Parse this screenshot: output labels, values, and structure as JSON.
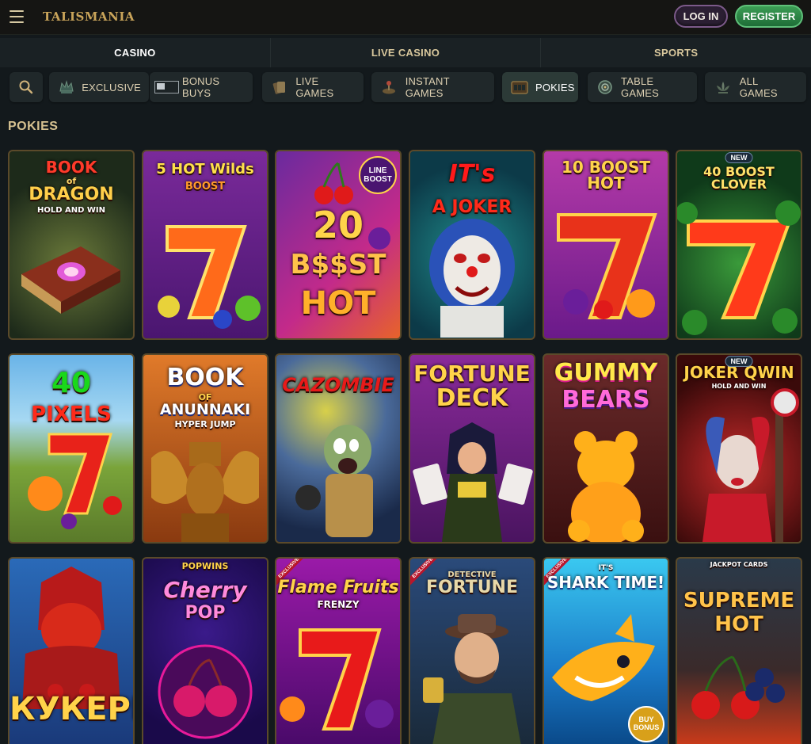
{
  "header": {
    "logo": "TALISMANIA",
    "login_label": "LOG IN",
    "register_label": "REGISTER"
  },
  "main_tabs": [
    {
      "label": "CASINO",
      "active": true
    },
    {
      "label": "LIVE CASINO",
      "active": false
    },
    {
      "label": "SPORTS",
      "active": false
    }
  ],
  "categories": [
    {
      "label": "",
      "icon": "search-icon"
    },
    {
      "label": "EXCLUSIVE",
      "icon": "crown-icon"
    },
    {
      "label": "BONUS BUYS",
      "icon": "broken-image-icon"
    },
    {
      "label": "LIVE GAMES",
      "icon": "cards-icon"
    },
    {
      "label": "INSTANT GAMES",
      "icon": "joystick-icon"
    },
    {
      "label": "POKIES",
      "icon": "slot-machine-icon",
      "active": true
    },
    {
      "label": "TABLE GAMES",
      "icon": "roulette-icon"
    },
    {
      "label": "ALL GAMES",
      "icon": "lotus-icon"
    }
  ],
  "section_title": "POKIES",
  "games": [
    {
      "title_lines": [
        "BOOK",
        "of",
        "DRAGON",
        "HOLD AND WIN"
      ],
      "badge": ""
    },
    {
      "title_lines": [
        "5 HOT Wilds",
        "BOOST"
      ],
      "badge": ""
    },
    {
      "title_lines": [
        "20",
        "B$$ST",
        "HOT"
      ],
      "badge": "",
      "corner": "LINE BOOST"
    },
    {
      "title_lines": [
        "IT's",
        "A JOKER"
      ],
      "badge": ""
    },
    {
      "title_lines": [
        "10 BOOST HOT"
      ],
      "badge": ""
    },
    {
      "title_lines": [
        "40 BOOST CLOVER"
      ],
      "badge": "NEW"
    },
    {
      "title_lines": [
        "40",
        "PIXELS"
      ],
      "badge": ""
    },
    {
      "title_lines": [
        "BOOK",
        "OF",
        "ANUNNAKI",
        "HYPER JUMP"
      ],
      "badge": ""
    },
    {
      "title_lines": [
        "CAZOMBIE"
      ],
      "badge": ""
    },
    {
      "title_lines": [
        "FORTUNE",
        "DECK"
      ],
      "badge": ""
    },
    {
      "title_lines": [
        "GUMMY",
        "BEARS"
      ],
      "badge": ""
    },
    {
      "title_lines": [
        "JOKER QWIN",
        "HOLD AND WIN"
      ],
      "badge": "NEW"
    },
    {
      "title_lines": [
        "КУКЕРИ"
      ],
      "badge": ""
    },
    {
      "title_lines": [
        "POPWINS",
        "Cherry",
        "POP"
      ],
      "badge": ""
    },
    {
      "title_lines": [
        "Flame Fruits",
        "FRENZY"
      ],
      "badge": "",
      "ribbon": "EXCLUSIVE"
    },
    {
      "title_lines": [
        "DETECTIVE",
        "FORTUNE"
      ],
      "badge": "",
      "ribbon": "EXCLUSIVE"
    },
    {
      "title_lines": [
        "IT'S",
        "SHARK TIME!"
      ],
      "badge": "",
      "ribbon": "EXCLUSIVE",
      "corner": "BUY BONUS"
    },
    {
      "title_lines": [
        "JACKPOT CARDS",
        "SUPREME",
        "HOT"
      ],
      "badge": ""
    }
  ],
  "colors": {
    "background": "#13191c",
    "accent_gold": "#d7c291",
    "register_green": "#2f8a4a",
    "login_purple": "#2b1f33"
  }
}
